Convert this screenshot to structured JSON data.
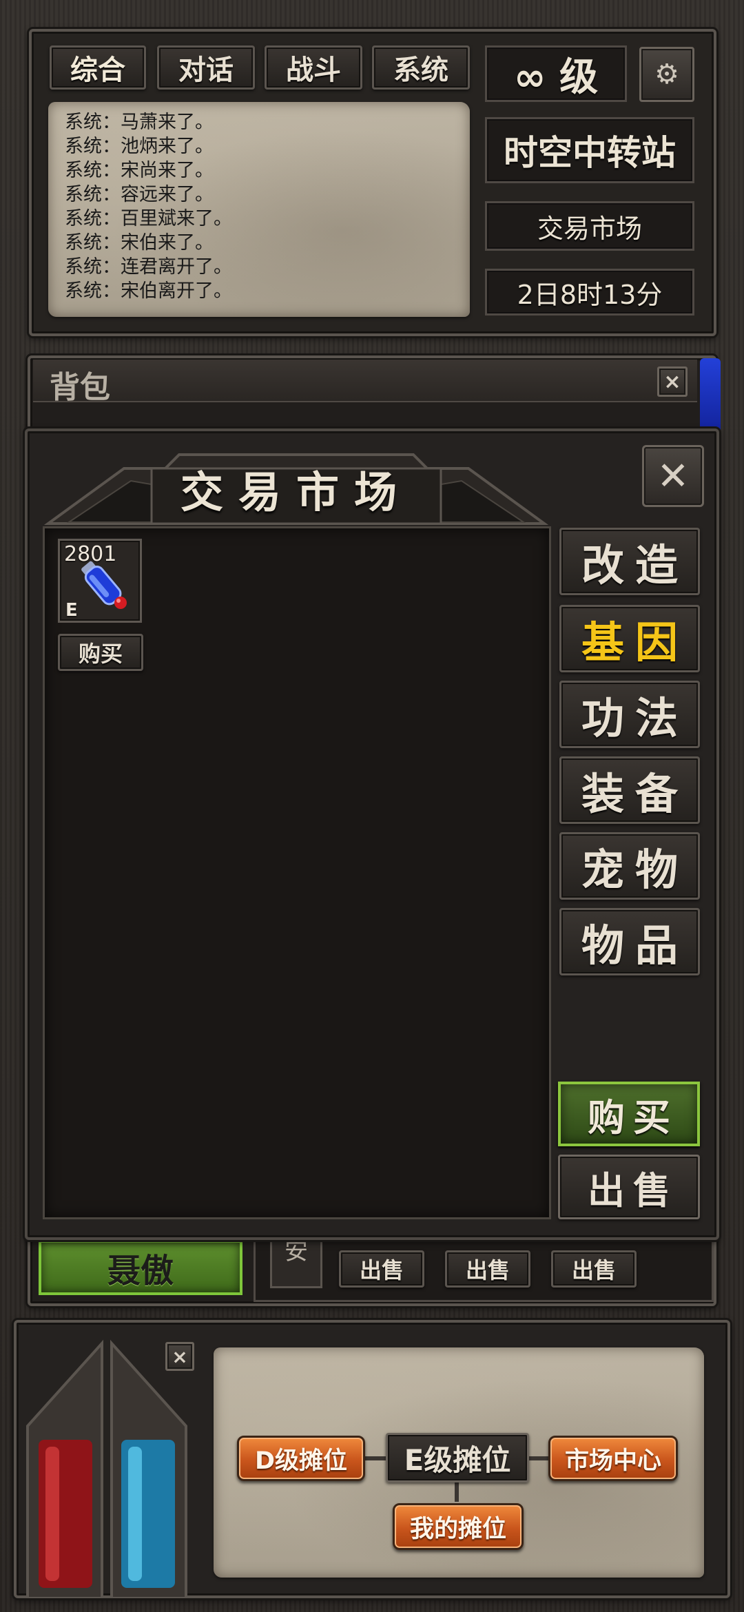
{
  "chat": {
    "tabs": [
      "综合",
      "对话",
      "战斗",
      "系统"
    ],
    "lines": [
      "系统：马萧来了。",
      "系统：池炳来了。",
      "系统：宋尚来了。",
      "系统：容远来了。",
      "系统：百里斌来了。",
      "系统：宋伯来了。",
      "系统：连君离开了。",
      "系统：宋伯离开了。"
    ]
  },
  "status": {
    "level": "∞ 级",
    "location": "时空中转站",
    "area": "交易市场",
    "time": "2日8时13分"
  },
  "backpack": {
    "title": "背包",
    "close": "×"
  },
  "market": {
    "title": "交易市场",
    "close": "✕",
    "items": [
      {
        "count": "2801",
        "grade": "E",
        "buy_label": "购买"
      }
    ],
    "categories": [
      "改造",
      "基因",
      "功法",
      "装备",
      "宠物",
      "物品"
    ],
    "active_category": "基因",
    "buy_label": "购买",
    "sell_label": "出售"
  },
  "behind": {
    "player_name": "聂傲",
    "partial_char": "安",
    "sell_buttons": [
      "出售",
      "出售",
      "出售"
    ]
  },
  "stall": {
    "close": "×",
    "d_stall": "D级摊位",
    "e_stall": "E级摊位",
    "market_center": "市场中心",
    "my_stall": "我的摊位"
  },
  "colors": {
    "active_category": "#f5c518",
    "health": "#c0262a",
    "mana": "#2aa6d8",
    "green_button": "#5f9a2a",
    "orange_button": "#d4651f"
  }
}
